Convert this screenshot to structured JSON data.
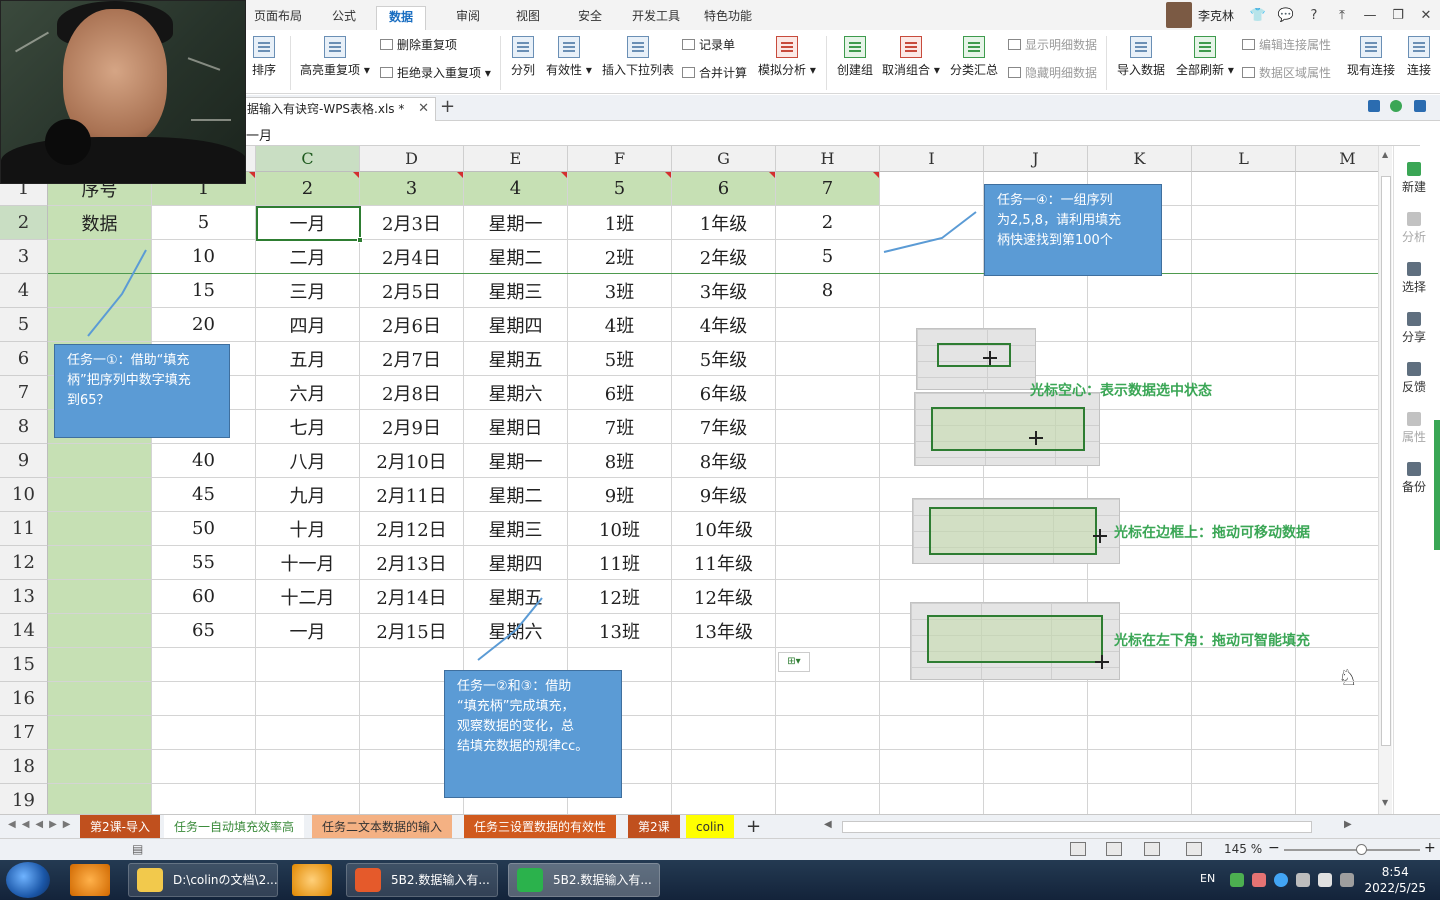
{
  "ribbon_tabs": [
    "页面布局",
    "公式",
    "数据",
    "审阅",
    "视图",
    "安全",
    "开发工具",
    "特色功能"
  ],
  "active_tab": "数据",
  "user_name": "李克林",
  "ribbon": {
    "sort": "排序",
    "highlight_dup": "高亮重复项 ▾",
    "delete_dup": "删除重复项",
    "reject_dup": "拒绝录入重复项 ▾",
    "split": "分列",
    "validity": "有效性 ▾",
    "insert_dropdown": "插入下拉列表",
    "record": "记录单",
    "consolidate": "合并计算",
    "simulate": "模拟分析 ▾",
    "create_group": "创建组",
    "ungroup": "取消组合 ▾",
    "subtotal": "分类汇总",
    "show_detail": "显示明细数据",
    "hide_detail": "隐藏明细数据",
    "import": "导入数据",
    "refresh_all": "全部刷新 ▾",
    "edit_conn": "编辑连接属性",
    "data_region": "数据区域属性",
    "existing_conn": "现有连接",
    "connect": "连接"
  },
  "doc_tab": "据输入有诀窍-WPS表格.xls *",
  "formula_value": "一月",
  "columns": [
    "C",
    "D",
    "E",
    "F",
    "G",
    "H",
    "I",
    "J",
    "K",
    "L",
    "M"
  ],
  "rows": [
    [
      "序号",
      "1",
      "2",
      "3",
      "4",
      "5",
      "6",
      "7"
    ],
    [
      "数据",
      "5",
      "一月",
      "2月3日",
      "星期一",
      "1班",
      "1年级",
      "2"
    ],
    [
      "",
      "10",
      "二月",
      "2月4日",
      "星期二",
      "2班",
      "2年级",
      "5"
    ],
    [
      "",
      "15",
      "三月",
      "2月5日",
      "星期三",
      "3班",
      "3年级",
      "8"
    ],
    [
      "",
      "20",
      "四月",
      "2月6日",
      "星期四",
      "4班",
      "4年级",
      ""
    ],
    [
      "",
      "",
      "五月",
      "2月7日",
      "星期五",
      "5班",
      "5年级",
      ""
    ],
    [
      "",
      "",
      "六月",
      "2月8日",
      "星期六",
      "6班",
      "6年级",
      ""
    ],
    [
      "",
      "",
      "七月",
      "2月9日",
      "星期日",
      "7班",
      "7年级",
      ""
    ],
    [
      "",
      "40",
      "八月",
      "2月10日",
      "星期一",
      "8班",
      "8年级",
      ""
    ],
    [
      "",
      "45",
      "九月",
      "2月11日",
      "星期二",
      "9班",
      "9年级",
      ""
    ],
    [
      "",
      "50",
      "十月",
      "2月12日",
      "星期三",
      "10班",
      "10年级",
      ""
    ],
    [
      "",
      "55",
      "十一月",
      "2月13日",
      "星期四",
      "11班",
      "11年级",
      ""
    ],
    [
      "",
      "60",
      "十二月",
      "2月14日",
      "星期五",
      "12班",
      "12年级",
      ""
    ],
    [
      "",
      "65",
      "一月",
      "2月15日",
      "星期六",
      "13班",
      "13年级",
      ""
    ],
    [
      "",
      "",
      "",
      "",
      "",
      "",
      "",
      ""
    ],
    [
      "",
      "",
      "",
      "",
      "",
      "",
      "",
      ""
    ],
    [
      "",
      "",
      "",
      "",
      "",
      "",
      "",
      ""
    ],
    [
      "",
      "",
      "",
      "",
      "",
      "",
      "",
      ""
    ],
    [
      "",
      "",
      "",
      "",
      "",
      "",
      "",
      ""
    ]
  ],
  "callouts": {
    "task1_1": [
      "任务一①：借助“填充",
      "柄”把序列中数字填充",
      "到65？"
    ],
    "task1_23": [
      "任务一②和③：借助",
      "“填充柄”完成填充，",
      "观察数据的变化，总",
      "结填充数据的规律cc。"
    ],
    "task1_4": [
      "任务一④：一组序列",
      "为2,5,8，请利用填充",
      "柄快速找到第100个"
    ]
  },
  "captions": {
    "hollow": "光标空心：表示数据选中状态",
    "border": "光标在边框上：拖动可移动数据",
    "corner": "光标在左下角：拖动可智能填充"
  },
  "side_panel": [
    "新建",
    "分析",
    "选择",
    "分享",
    "反馈",
    "属性",
    "备份"
  ],
  "sheet_tabs": [
    {
      "label": "第2课-导入",
      "bg": "#c0501e",
      "fg": "#ffffff"
    },
    {
      "label": "任务一自动填充效率高",
      "bg": "#ffffff",
      "fg": "#3a8a3a"
    },
    {
      "label": "任务二文本数据的输入",
      "bg": "#f4b183",
      "fg": "#333333"
    },
    {
      "label": "任务三设置数据的有效性",
      "bg": "#d05a1e",
      "fg": "#ffffff"
    },
    {
      "label": "第2课",
      "bg": "#c0501e",
      "fg": "#ffffff"
    },
    {
      "label": "colin",
      "bg": "#ffff00",
      "fg": "#333333"
    }
  ],
  "zoom": "145 %",
  "taskbar_apps": [
    "D:\\colinの文档\\2...",
    "5B2.数据输入有...",
    "5B2.数据输入有..."
  ],
  "tray_lang": "EN",
  "clock": {
    "time": "8:54",
    "date": "2022/5/25"
  },
  "colors": {
    "header_green": "#c6e0b4",
    "label_green": "#c6e0b4",
    "callout_blue": "#5b9bd5",
    "caption_green": "#3aa655"
  }
}
